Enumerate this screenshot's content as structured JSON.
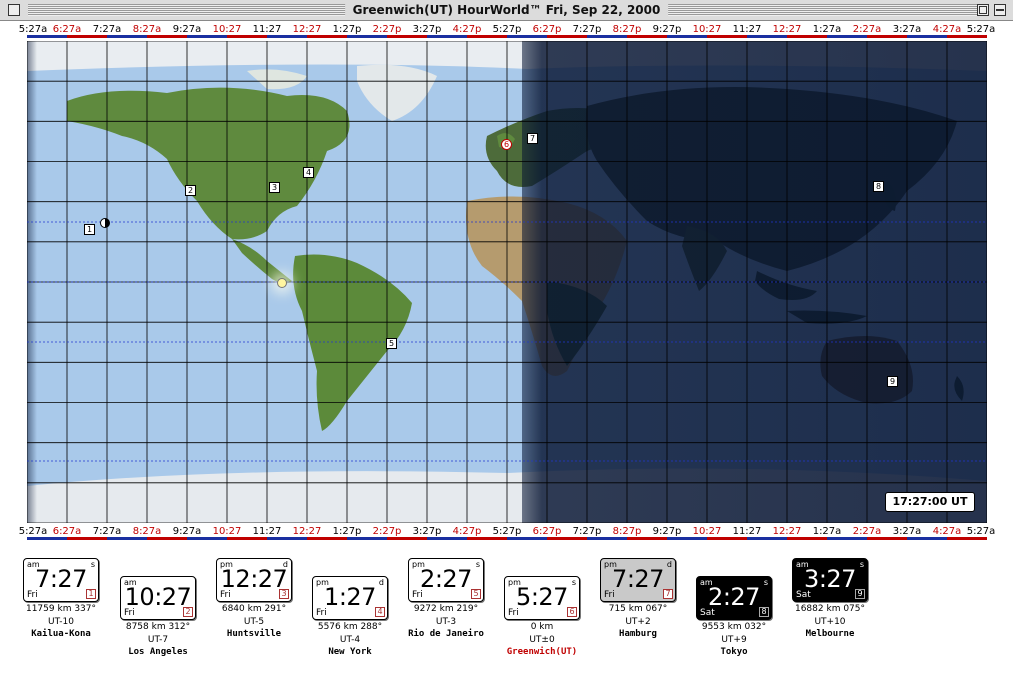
{
  "window": {
    "title": "Greenwich(UT)   HourWorld™   Fri, Sep 22, 2000"
  },
  "time_labels": [
    {
      "label": "5:27a",
      "night": false
    },
    {
      "label": "6:27a",
      "night": true
    },
    {
      "label": "7:27a",
      "night": false
    },
    {
      "label": "8:27a",
      "night": true
    },
    {
      "label": "9:27a",
      "night": false
    },
    {
      "label": "10:27",
      "night": true
    },
    {
      "label": "11:27",
      "night": false
    },
    {
      "label": "12:27",
      "night": true
    },
    {
      "label": "1:27p",
      "night": false
    },
    {
      "label": "2:27p",
      "night": true
    },
    {
      "label": "3:27p",
      "night": false
    },
    {
      "label": "4:27p",
      "night": true
    },
    {
      "label": "5:27p",
      "night": false
    },
    {
      "label": "6:27p",
      "night": true
    },
    {
      "label": "7:27p",
      "night": false
    },
    {
      "label": "8:27p",
      "night": true
    },
    {
      "label": "9:27p",
      "night": false
    },
    {
      "label": "10:27",
      "night": true
    },
    {
      "label": "11:27",
      "night": false
    },
    {
      "label": "12:27",
      "night": true
    },
    {
      "label": "1:27a",
      "night": false
    },
    {
      "label": "2:27a",
      "night": true
    },
    {
      "label": "3:27a",
      "night": false
    },
    {
      "label": "4:27a",
      "night": true
    },
    {
      "label": "5:27a",
      "night": false
    }
  ],
  "map_markers": [
    "1",
    "2",
    "3",
    "4",
    "5",
    "6",
    "7",
    "8",
    "9"
  ],
  "ut_clock": "17:27:00 UT",
  "colors": {
    "night_label": "#c00000",
    "home_city": "#c00000",
    "ocean": "#a9c9ea",
    "land": "#5f8a3e"
  },
  "clocks": [
    {
      "ampm": "am",
      "sd": "s",
      "time": "7:27",
      "day": "Fri",
      "num": "1",
      "dist": "11759 km 337°",
      "utc": "UT-10",
      "name": "Kailua-Kona",
      "style": "light",
      "home": false
    },
    {
      "ampm": "am",
      "sd": "",
      "time": "10:27",
      "day": "Fri",
      "num": "2",
      "dist": "8758 km 312°",
      "utc": "UT-7",
      "name": "Los Angeles",
      "style": "light",
      "home": false
    },
    {
      "ampm": "pm",
      "sd": "d",
      "time": "12:27",
      "day": "Fri",
      "num": "3",
      "dist": "6840 km 291°",
      "utc": "UT-5",
      "name": "Huntsville",
      "style": "light",
      "home": false
    },
    {
      "ampm": "pm",
      "sd": "d",
      "time": "1:27",
      "day": "Fri",
      "num": "4",
      "dist": "5576 km 288°",
      "utc": "UT-4",
      "name": "New York",
      "style": "light",
      "home": false
    },
    {
      "ampm": "pm",
      "sd": "s",
      "time": "2:27",
      "day": "Fri",
      "num": "5",
      "dist": "9272 km 219°",
      "utc": "UT-3",
      "name": "Rio de Janeiro",
      "style": "light",
      "home": false
    },
    {
      "ampm": "pm",
      "sd": "s",
      "time": "5:27",
      "day": "Fri",
      "num": "6",
      "dist": "0 km",
      "utc": "UT±0",
      "name": "Greenwich(UT)",
      "style": "light",
      "home": true
    },
    {
      "ampm": "pm",
      "sd": "d",
      "time": "7:27",
      "day": "Fri",
      "num": "7",
      "dist": "715 km 067°",
      "utc": "UT+2",
      "name": "Hamburg",
      "style": "grey",
      "home": false
    },
    {
      "ampm": "am",
      "sd": "s",
      "time": "2:27",
      "day": "Sat",
      "num": "8",
      "dist": "9553 km 032°",
      "utc": "UT+9",
      "name": "Tokyo",
      "style": "dark",
      "home": false
    },
    {
      "ampm": "am",
      "sd": "s",
      "time": "3:27",
      "day": "Sat",
      "num": "9",
      "dist": "16882 km 075°",
      "utc": "UT+10",
      "name": "Melbourne",
      "style": "dark",
      "home": false
    }
  ]
}
